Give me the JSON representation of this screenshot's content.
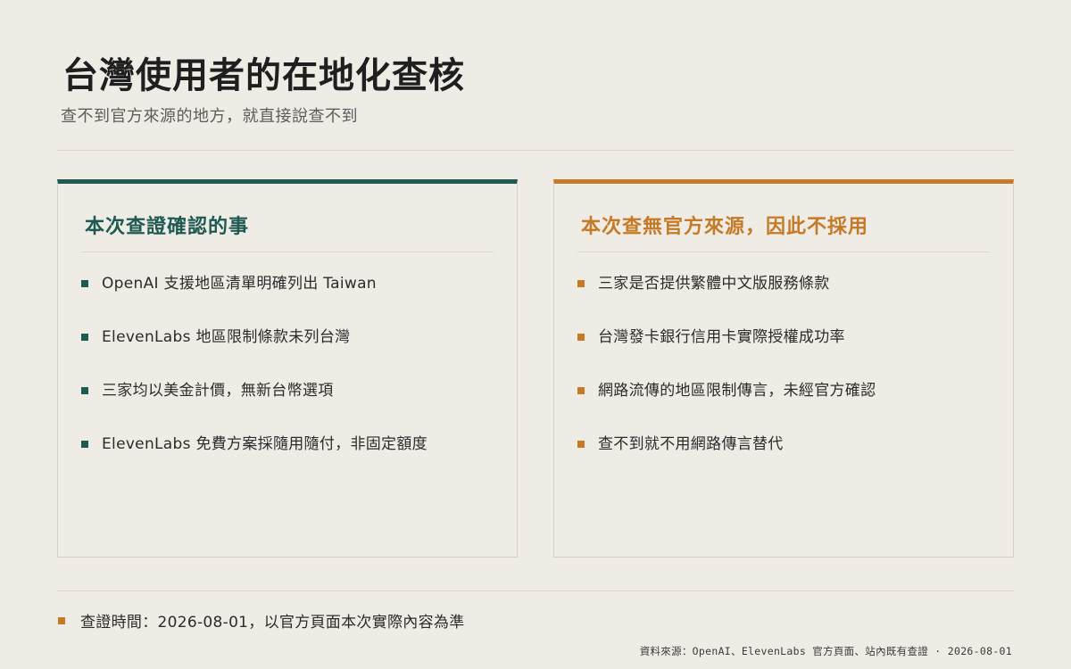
{
  "header": {
    "title": "台灣使用者的在地化查核",
    "subtitle": "查不到官方來源的地方，就直接說查不到"
  },
  "confirmed": {
    "title": "本次查證確認的事",
    "accent_color": "#1e5a52",
    "items": [
      "OpenAI 支援地區清單明確列出 Taiwan",
      "ElevenLabs 地區限制條款未列台灣",
      "三家均以美金計價，無新台幣選項",
      "ElevenLabs 免費方案採隨用隨付，非固定額度"
    ]
  },
  "unverified": {
    "title": "本次查無官方來源，因此不採用",
    "accent_color": "#c47a26",
    "items": [
      "三家是否提供繁體中文版服務條款",
      "台灣發卡銀行信用卡實際授權成功率",
      "網路流傳的地區限制傳言，未經官方確認",
      "查不到就不用網路傳言替代"
    ]
  },
  "footer": {
    "note": "查證時間：2026-08-01，以官方頁面本次實際內容為準",
    "source": "資料來源：OpenAI、ElevenLabs 官方頁面、站內既有查證 · 2026-08-01"
  }
}
